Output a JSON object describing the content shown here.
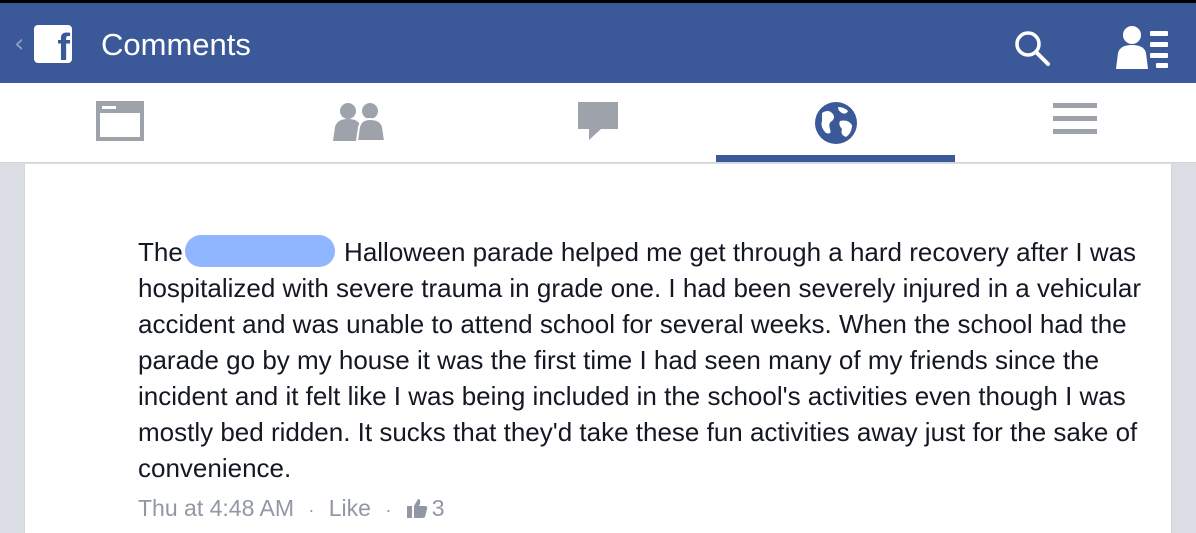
{
  "header": {
    "back_icon": "chevron-left-icon",
    "logo_icon": "facebook-logo-icon",
    "title": "Comments",
    "search_icon": "search-icon",
    "friends_icon": "friend-requests-icon"
  },
  "tabs": [
    {
      "icon": "news-feed-icon"
    },
    {
      "icon": "friends-icon"
    },
    {
      "icon": "messages-icon"
    },
    {
      "icon": "notifications-globe-icon",
      "active": true
    },
    {
      "icon": "menu-icon"
    }
  ],
  "comment": {
    "text_before": "The",
    "text_after": "Halloween parade helped me get through a hard recovery after I was hospitalized with severe trauma in grade one. I had been severely injured in a vehicular accident and was unable to attend school for several weeks. When the school had the parade go by my house it was the first time I had seen many of my friends since the incident and it felt like I was being included in the school's activities even though I was mostly bed ridden. It sucks that they'd take these fun activities away just for the sake of convenience.",
    "timestamp": "Thu at 4:48 AM",
    "separator": "·",
    "like_label": "Like",
    "like_count": "3"
  },
  "colors": {
    "brand": "#3b5998",
    "redaction": "#8fb6ff",
    "meta_text": "#9197a3",
    "tab_icon": "#9ea3ab"
  }
}
